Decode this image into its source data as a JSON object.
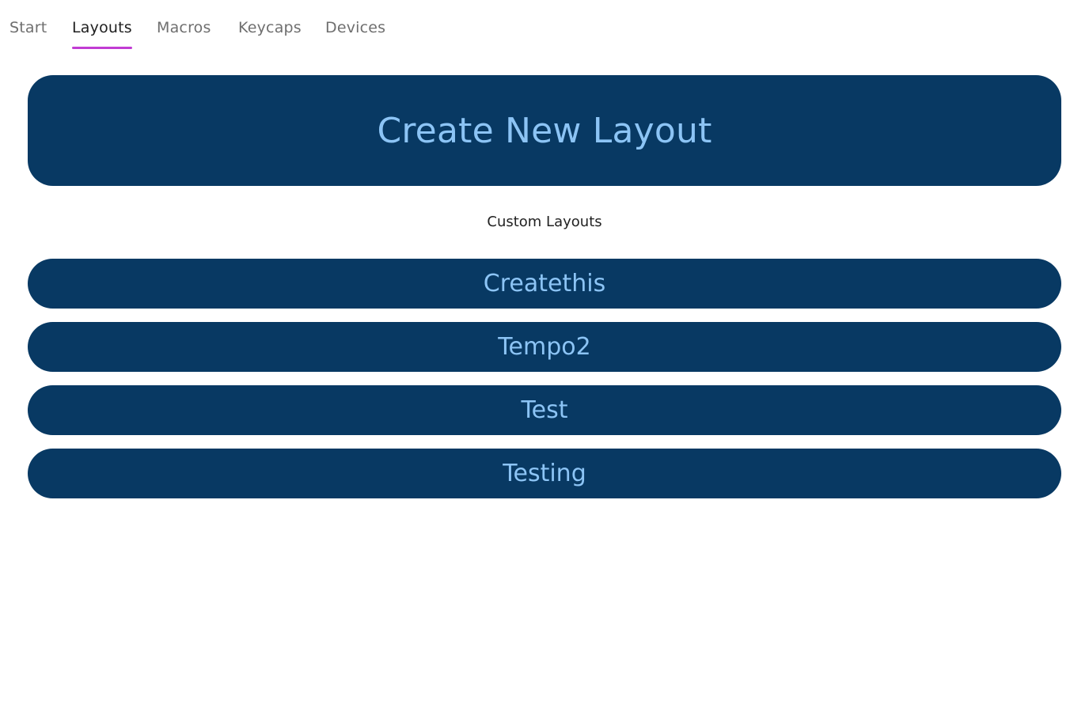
{
  "colors": {
    "button_bg": "#083963",
    "button_text": "#8cc4f5",
    "tab_accent": "#c13bd3"
  },
  "tabs": [
    {
      "label": "Start",
      "active": false
    },
    {
      "label": "Layouts",
      "active": true
    },
    {
      "label": "Macros",
      "active": false
    },
    {
      "label": "Keycaps",
      "active": false
    },
    {
      "label": "Devices",
      "active": false
    }
  ],
  "main": {
    "create_button_label": "Create New Layout",
    "section_label": "Custom Layouts",
    "layouts": [
      "Createthis",
      "Tempo2",
      "Test",
      "Testing"
    ]
  }
}
